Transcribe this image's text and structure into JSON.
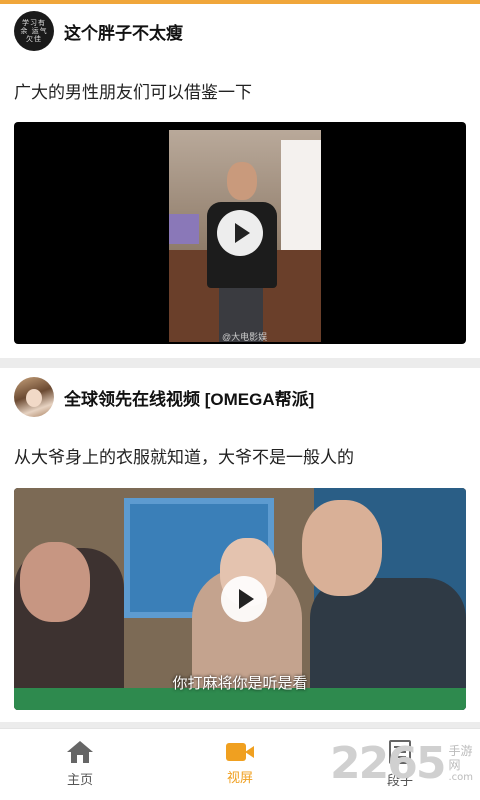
{
  "posts": [
    {
      "author": "这个胖子不太瘦",
      "avatar_text": "学习有余\n运气欠佳",
      "title": "广大的男性朋友们可以借鉴一下",
      "video": {
        "watermark": "@大电影娱"
      }
    },
    {
      "author": "全球领先在线视频 [OMEGA帮派]",
      "title": "从大爷身上的衣服就知道，大爷不是一般人的",
      "video": {
        "subtitle": "你打麻将你是听是看"
      }
    }
  ],
  "tabs": [
    {
      "label": "主页",
      "icon": "home-icon",
      "active": false
    },
    {
      "label": "视屏",
      "icon": "video-camera-icon",
      "active": true
    },
    {
      "label": "段子",
      "icon": "document-icon",
      "active": false
    }
  ],
  "brand": {
    "number": "2265",
    "text": "手游网",
    "url": ".com"
  },
  "colors": {
    "accent": "#f0a020",
    "top_bar": "#f0a63a"
  }
}
